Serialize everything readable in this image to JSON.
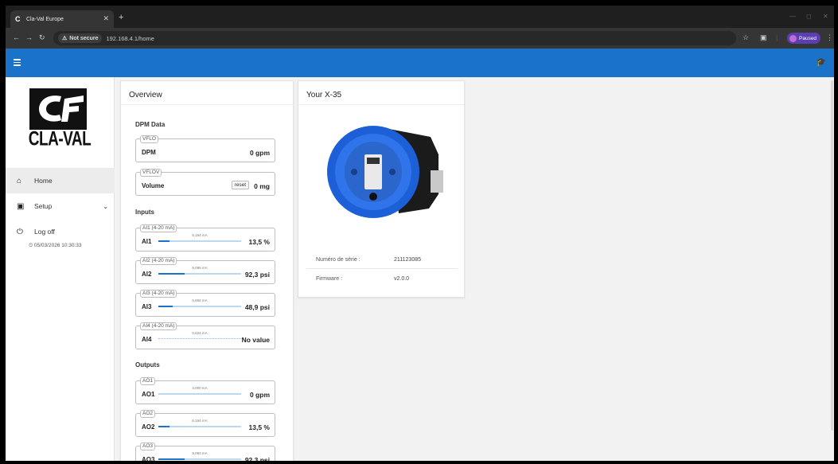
{
  "browser": {
    "tab_title": "Cla-Val Europe",
    "security_label": "Not secure",
    "url": "192.168.4.1/home",
    "profile_label": "Paused"
  },
  "sidebar": {
    "brand": "CLA-VAL",
    "items": [
      {
        "label": "Home",
        "icon": "home-icon"
      },
      {
        "label": "Setup",
        "icon": "setup-icon"
      },
      {
        "label": "Log off",
        "icon": "power-icon"
      }
    ],
    "datetime": "05/03/2026 10:30:33"
  },
  "overview": {
    "title": "Overview",
    "dpm_section": "DPM Data",
    "dpm": [
      {
        "legend": "VFLO",
        "label": "DPM",
        "value": "0 gpm"
      },
      {
        "legend": "VFLOV",
        "label": "Volume",
        "value": "0 mg",
        "button": "reset"
      }
    ],
    "inputs_section": "Inputs",
    "inputs": [
      {
        "legend": "AI1 (4-20 mA)",
        "label": "AI1",
        "ma": "6,164 mA",
        "level": 0.135,
        "value": "13,5 %"
      },
      {
        "legend": "AI2 (4-20 mA)",
        "label": "AI2",
        "ma": "9,095 mA",
        "level": 0.32,
        "value": "92,3 psi"
      },
      {
        "legend": "AI3 (4-20 mA)",
        "label": "AI3",
        "ma": "6,692 mA",
        "level": 0.17,
        "value": "48,9 psi"
      },
      {
        "legend": "AI4 (4-20 mA)",
        "label": "AI4",
        "ma": "0,624 mA",
        "level": 0,
        "value": "No value"
      }
    ],
    "outputs_section": "Outputs",
    "outputs": [
      {
        "legend": "AO1",
        "label": "AO1",
        "ma": "4,000 mA",
        "level": 0,
        "value": "0 gpm"
      },
      {
        "legend": "AO2",
        "label": "AO2",
        "ma": "6,164 mA",
        "level": 0.135,
        "value": "13,5 %"
      },
      {
        "legend": "AO3",
        "label": "AO3",
        "ma": "9,093 mA",
        "level": 0.32,
        "value": "92,3 psi"
      }
    ]
  },
  "device": {
    "title": "Your X-35",
    "serial_label": "Numéro de série :",
    "serial_value": "211123085",
    "firmware_label": "Firmware :",
    "firmware_value": "v2.0.0"
  },
  "colors": {
    "accent": "#1a73c9",
    "bar_track": "#bcd7f0"
  }
}
